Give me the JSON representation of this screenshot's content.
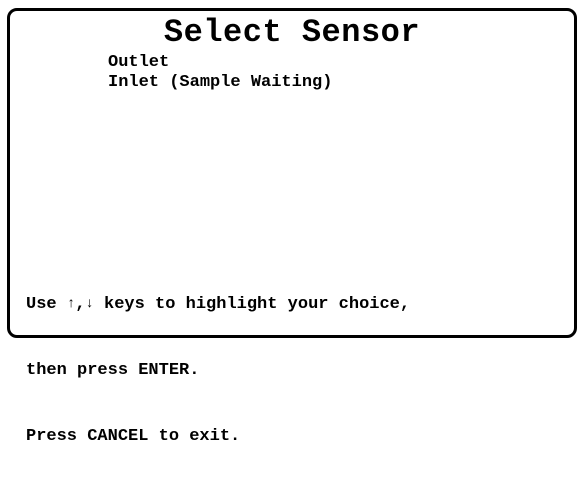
{
  "screen": {
    "title": "Select Sensor",
    "menu_items": [
      {
        "label": "Outlet"
      },
      {
        "label": "Inlet (Sample Waiting)"
      }
    ],
    "instructions": {
      "line1_prefix": "Use ",
      "up_arrow": "↑",
      "comma": ",",
      "down_arrow": "↓",
      "line1_suffix": " keys to highlight your choice,",
      "line2": "then press ENTER.",
      "line3": "Press CANCEL to exit."
    }
  },
  "colors": {
    "background": "#ffffff",
    "foreground": "#000000"
  }
}
